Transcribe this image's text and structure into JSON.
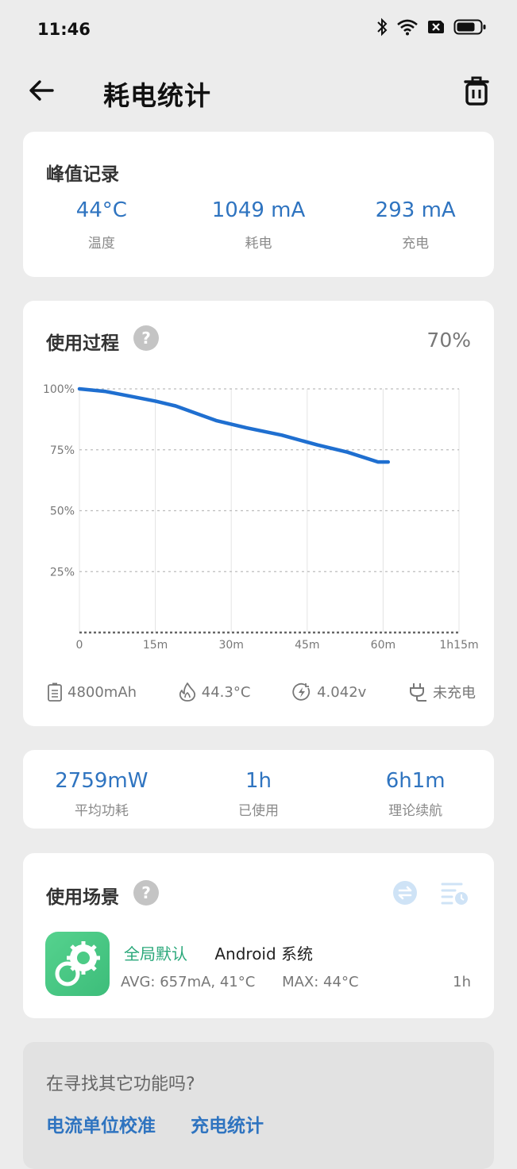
{
  "status_bar": {
    "time": "11:46"
  },
  "app_bar": {
    "title": "耗电统计"
  },
  "peak": {
    "title": "峰值记录",
    "items": [
      {
        "value": "44°C",
        "label": "温度"
      },
      {
        "value": "1049 mA",
        "label": "耗电"
      },
      {
        "value": "293 mA",
        "label": "充电"
      }
    ]
  },
  "usage": {
    "title": "使用过程",
    "help": "?",
    "percent": "70%",
    "info": {
      "capacity": "4800mAh",
      "temperature": "44.3°C",
      "voltage": "4.042v",
      "charging": "未充电"
    }
  },
  "chart_data": {
    "type": "line",
    "x_ticks": [
      "0",
      "15m",
      "30m",
      "45m",
      "60m",
      "1h15m"
    ],
    "y_ticks": [
      "25%",
      "50%",
      "75%",
      "100%"
    ],
    "xlim_minutes": [
      0,
      75
    ],
    "ylim": [
      0,
      100
    ],
    "grid": true,
    "series": [
      {
        "color": "#1f6fd0",
        "points": [
          [
            0,
            100
          ],
          [
            5,
            99
          ],
          [
            10,
            97
          ],
          [
            15,
            95
          ],
          [
            19,
            93
          ],
          [
            27,
            87
          ],
          [
            33,
            84
          ],
          [
            40,
            81
          ],
          [
            47,
            77
          ],
          [
            53,
            74
          ],
          [
            59,
            70
          ],
          [
            61,
            70
          ]
        ]
      }
    ]
  },
  "summary": {
    "items": [
      {
        "value": "2759mW",
        "label": "平均功耗"
      },
      {
        "value": "1h",
        "label": "已使用"
      },
      {
        "value": "6h1m",
        "label": "理论续航"
      }
    ]
  },
  "scene": {
    "title": "使用场景",
    "help": "?",
    "app": {
      "tag": "全局默认",
      "name": "Android 系统",
      "avg": "AVG: 657mA, 41°C",
      "max": "MAX:  44°C",
      "duration": "1h"
    }
  },
  "more": {
    "title": "在寻找其它功能吗?",
    "links": [
      "电流单位校准",
      "充电统计"
    ]
  },
  "colors": {
    "accent": "#2f74c0",
    "green": "#2aa87a",
    "line": "#1f6fd0"
  }
}
